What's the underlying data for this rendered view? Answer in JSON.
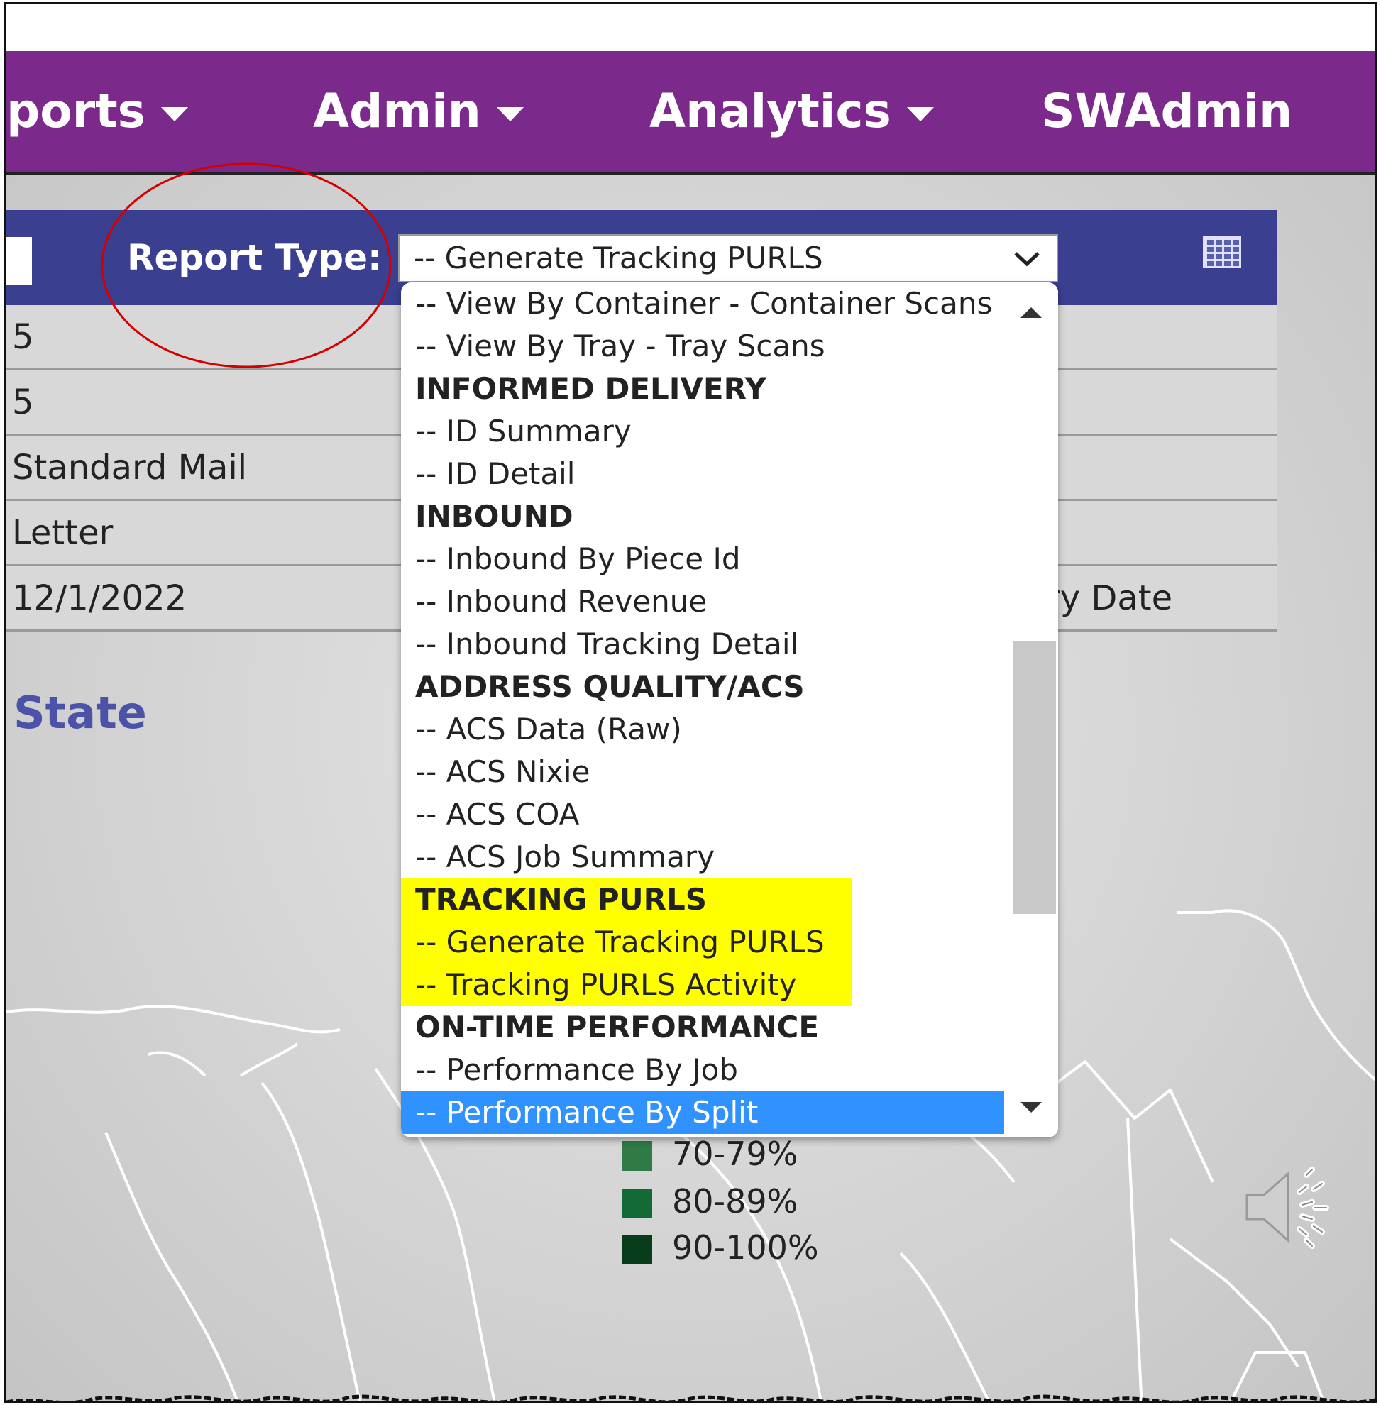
{
  "navbar": {
    "items": [
      {
        "label": "ports",
        "has_caret": true
      },
      {
        "label": "Admin",
        "has_caret": true
      },
      {
        "label": "Analytics",
        "has_caret": true
      },
      {
        "label": "SWAdmin",
        "has_caret": false
      }
    ],
    "color": "#7b2a8c"
  },
  "report_type": {
    "label": "Report Type:",
    "selected_value": "-- Generate Tracking PURLS",
    "options": [
      {
        "label": "-- View By Container - Container Scans"
      },
      {
        "label": "-- View By Tray - Tray Scans"
      },
      {
        "label": "INFORMED DELIVERY",
        "group": true
      },
      {
        "label": "-- ID Summary"
      },
      {
        "label": "-- ID Detail"
      },
      {
        "label": "INBOUND",
        "group": true
      },
      {
        "label": "-- Inbound By Piece Id"
      },
      {
        "label": "-- Inbound Revenue"
      },
      {
        "label": "-- Inbound Tracking Detail"
      },
      {
        "label": "ADDRESS QUALITY/ACS",
        "group": true
      },
      {
        "label": "-- ACS Data (Raw)"
      },
      {
        "label": "-- ACS Nixie"
      },
      {
        "label": "-- ACS COA"
      },
      {
        "label": "-- ACS Job Summary"
      },
      {
        "label": "TRACKING PURLS",
        "group": true,
        "highlight": true
      },
      {
        "label": "-- Generate Tracking PURLS",
        "highlight": true
      },
      {
        "label": "-- Tracking PURLS Activity",
        "highlight": true
      },
      {
        "label": "ON-TIME PERFORMANCE",
        "group": true
      },
      {
        "label": "-- Performance By Job"
      },
      {
        "label": "-- Performance By Split",
        "selected": true
      }
    ]
  },
  "table": {
    "rows": [
      {
        "value": "5",
        "right": ""
      },
      {
        "value": "5",
        "right": ""
      },
      {
        "value": "Standard Mail",
        "right": ""
      },
      {
        "value": "Letter",
        "right": ""
      },
      {
        "value": "12/1/2022",
        "right": "ry Date"
      }
    ]
  },
  "map": {
    "title": "State",
    "legend": [
      {
        "label": "70-79%",
        "color": "#2f7a45"
      },
      {
        "label": "80-89%",
        "color": "#146a36"
      },
      {
        "label": "90-100%",
        "color": "#083d1c"
      }
    ]
  },
  "colors": {
    "report_bar": "#3a3f8f",
    "highlight": "#ffff00",
    "selected": "#2f92ff",
    "annotation": "#d40000"
  },
  "icons": {
    "grid": "grid-icon",
    "speaker": "speaker-icon",
    "chevron": "chevron-down-icon"
  }
}
